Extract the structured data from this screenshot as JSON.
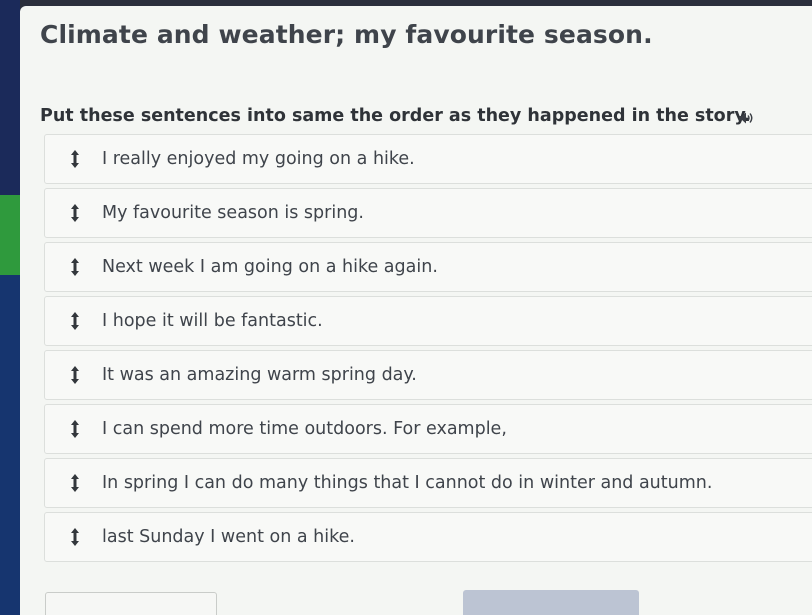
{
  "page": {
    "title": "Climate and weather; my favourite season.",
    "instruction": "Put these sentences into same the order as they happened in the story."
  },
  "icons": {
    "audio": "speaker-icon",
    "drag": "vertical-drag-arrow-icon"
  },
  "items": [
    "I really enjoyed my going on a hike.",
    "My favourite season is spring.",
    "Next week I am going on a hike again.",
    "I hope it will be fantastic.",
    "It was an amazing warm spring day.",
    "I can spend more time outdoors. For example,",
    "In spring I can do many things that I cannot do in winter and autumn.",
    "last Sunday I went on a hike."
  ],
  "colors": {
    "background": "#f4f6f3",
    "text": "#3f444b",
    "accent_button": "#bcc4d3"
  }
}
